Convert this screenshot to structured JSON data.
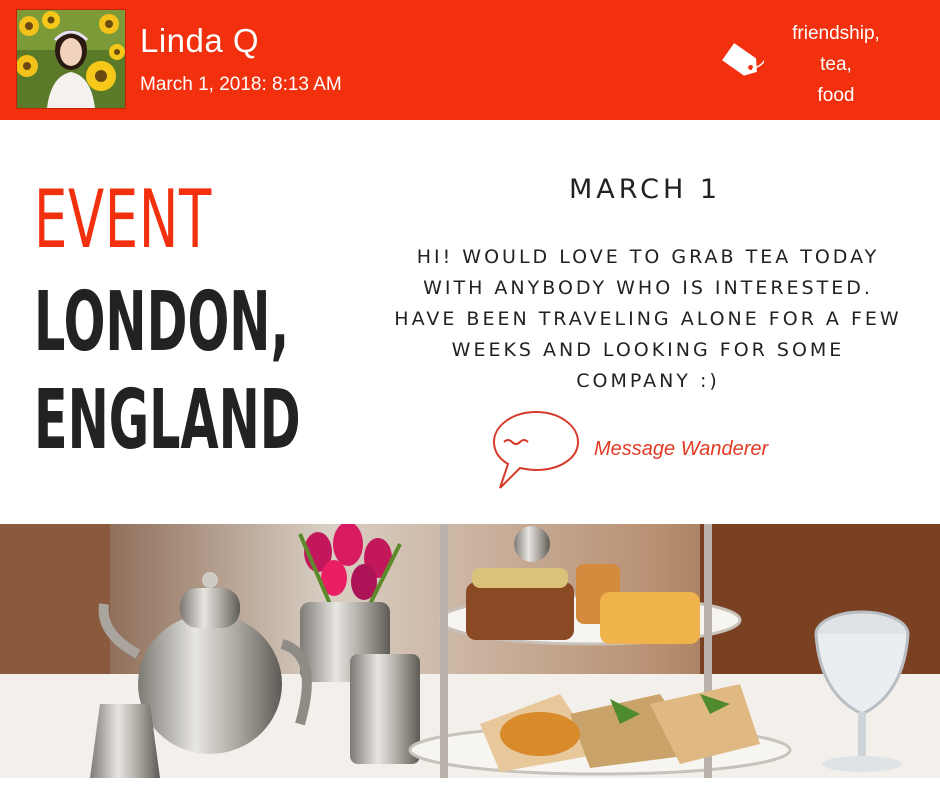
{
  "header": {
    "author_name": "Linda Q",
    "timestamp": "March 1, 2018: 8:13 AM",
    "tags": [
      "friendship,",
      "tea,",
      "food"
    ],
    "tag_icon": "tag-icon",
    "background_color": "#f2300e"
  },
  "event": {
    "label": "EVENT",
    "location_line1": "LONDON,",
    "location_line2": "ENGLAND"
  },
  "post": {
    "date_heading": "MARCH 1",
    "message": "HI! WOULD LOVE TO GRAB TEA TODAY WITH ANYBODY WHO IS INTERESTED. HAVE BEEN TRAVELING ALONE FOR A FEW WEEKS AND LOOKING FOR SOME COMPANY :)"
  },
  "action": {
    "message_label": "Message Wanderer",
    "icon": "speech-bubble-icon",
    "accent_color": "#e23a22"
  },
  "photo": {
    "icon": "afternoon-tea-photo"
  }
}
